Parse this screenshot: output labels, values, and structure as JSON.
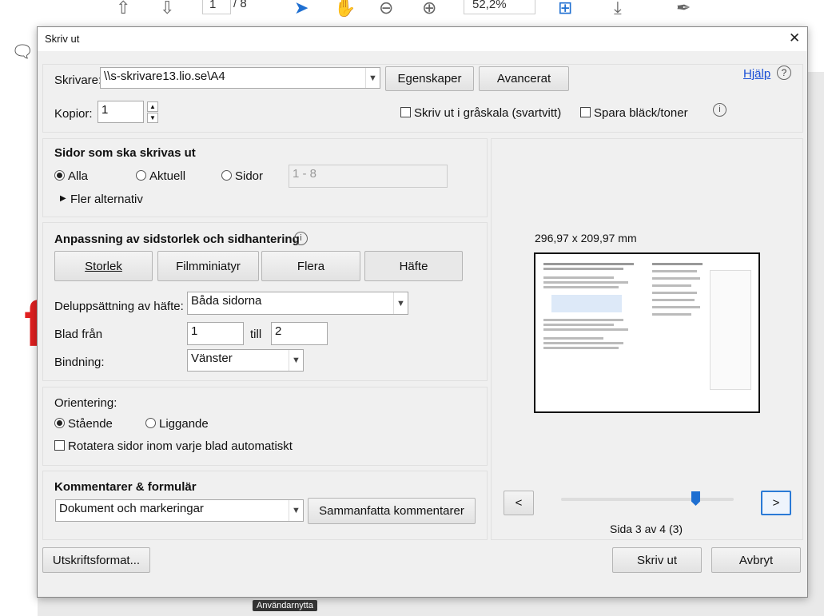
{
  "toolbar": {
    "page_current": "1",
    "page_total": "/ 8",
    "zoom": "52,2%"
  },
  "dialog": {
    "title": "Skriv ut",
    "close_icon": "close-icon",
    "help_link": "Hjälp",
    "printer_label": "Skrivare:",
    "printer_value": "\\\\s-skrivare13.lio.se\\A4",
    "properties_button": "Egenskaper",
    "advanced_button": "Avancerat",
    "copies_label": "Kopior:",
    "copies_value": "1",
    "grayscale_label": "Skriv ut i gråskala (svartvitt)",
    "save_ink_label": "Spara bläck/toner",
    "pages_section": {
      "title": "Sidor som ska skrivas ut",
      "all": "Alla",
      "current": "Aktuell",
      "pages": "Sidor",
      "pages_range_placeholder": "1 - 8",
      "more_options": "Fler alternativ"
    },
    "sizing_section": {
      "title": "Anpassning av sidstorlek och sidhantering",
      "tabs": [
        "Storlek",
        "Filmminiatyr",
        "Flera",
        "Häfte"
      ],
      "booklet_subset_label": "Deluppsättning av häfte:",
      "booklet_subset_value": "Båda sidorna",
      "sheets_from_label": "Blad från",
      "sheets_from_value": "1",
      "to_label": "till",
      "sheets_to_value": "2",
      "binding_label": "Bindning:",
      "binding_value": "Vänster"
    },
    "orientation_section": {
      "title": "Orientering:",
      "portrait": "Stående",
      "landscape": "Liggande",
      "auto_rotate": "Rotatera sidor inom varje blad automatiskt"
    },
    "comments_section": {
      "title": "Kommentarer & formulär",
      "value": "Dokument och markeringar",
      "summarize_button": "Sammanfatta kommentarer"
    },
    "preview": {
      "size": "296,97 x 209,97 mm",
      "page_info": "Sida 3 av 4 (3)",
      "prev": "<",
      "next": ">",
      "slider_position": 0.78
    },
    "page_setup_button": "Utskriftsformat...",
    "print_button": "Skriv ut",
    "cancel_button": "Avbryt"
  },
  "tooltip": "Användarnytta"
}
